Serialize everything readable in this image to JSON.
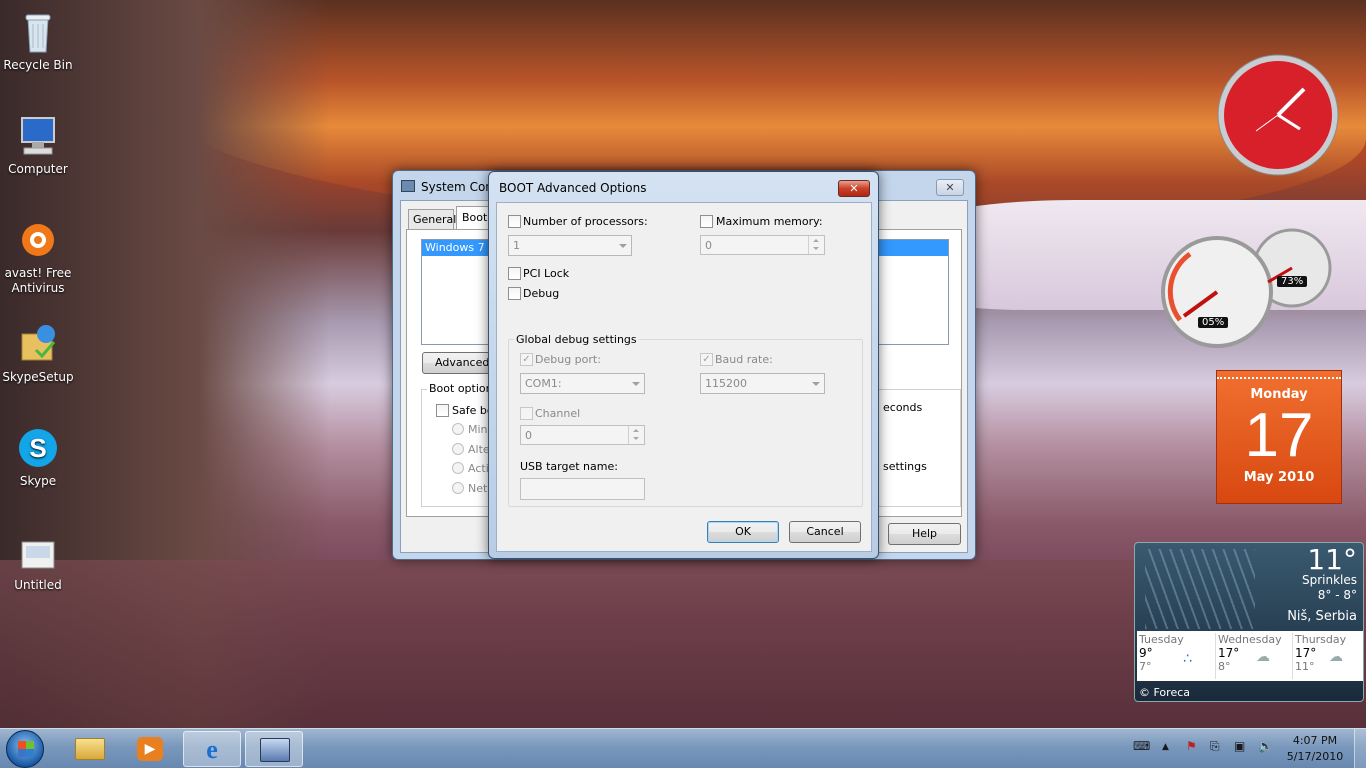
{
  "desktop": {
    "icons": [
      {
        "label": "Recycle Bin"
      },
      {
        "label": "Computer"
      },
      {
        "label": "avast! Free Antivirus"
      },
      {
        "label": "SkypeSetup"
      },
      {
        "label": "Skype"
      },
      {
        "label": "Untitled"
      }
    ]
  },
  "syscfg": {
    "title": "System Conf",
    "tabs": [
      "General",
      "Boot"
    ],
    "os_entry": "Windows 7 (C",
    "advanced_btn": "Advanced o",
    "boot_options": "Boot options",
    "safe_boot": "Safe bo",
    "radios": [
      "Minin",
      "Alter",
      "Activ",
      "Netw"
    ],
    "seconds": "econds",
    "settings": "settings",
    "help": "Help"
  },
  "dialog": {
    "title": "BOOT Advanced Options",
    "num_processors": "Number of processors:",
    "num_processors_value": "1",
    "max_memory": "Maximum memory:",
    "max_memory_value": "0",
    "pci_lock": "PCI Lock",
    "debug": "Debug",
    "global_debug": "Global debug settings",
    "debug_port": "Debug port:",
    "debug_port_value": "COM1:",
    "baud_rate": "Baud rate:",
    "baud_rate_value": "115200",
    "channel": "Channel",
    "channel_value": "0",
    "usb_target": "USB target name:",
    "ok": "OK",
    "cancel": "Cancel"
  },
  "gadgets": {
    "cpu_percent": "05%",
    "mem_percent": "73%",
    "calendar": {
      "day": "Monday",
      "date": "17",
      "month": "May 2010"
    },
    "weather": {
      "temp": "11°",
      "cond": "Sprinkles",
      "range": "8° - 8°",
      "place": "Niš, Serbia",
      "days": [
        {
          "name": "Tuesday",
          "hi": "9°",
          "lo": "7°"
        },
        {
          "name": "Wednesday",
          "hi": "17°",
          "lo": "8°"
        },
        {
          "name": "Thursday",
          "hi": "17°",
          "lo": "11°"
        }
      ],
      "credit": "© Foreca"
    }
  },
  "taskbar": {
    "time": "4:07 PM",
    "date": "5/17/2010"
  }
}
